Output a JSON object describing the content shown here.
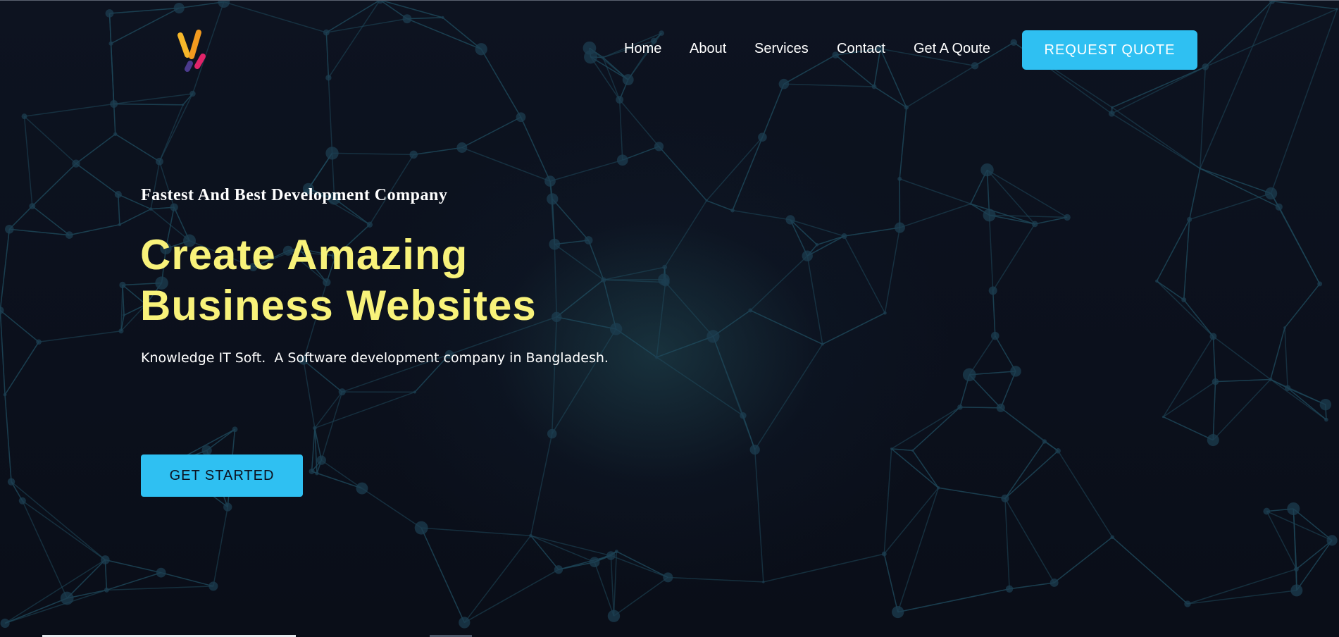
{
  "nav": {
    "items": [
      {
        "label": "Home"
      },
      {
        "label": "About"
      },
      {
        "label": "Services"
      },
      {
        "label": "Contact"
      },
      {
        "label": "Get A Qoute"
      }
    ],
    "cta_label": "REQUEST QUOTE"
  },
  "hero": {
    "tagline": "Fastest And Best Development Company",
    "headline_line1": "Create Amazing",
    "headline_line2": "Business Websites",
    "description": "Knowledge IT Soft.  A Software development company in Bangladesh.",
    "cta_label": "GET STARTED"
  },
  "colors": {
    "background": "#0b0f1a",
    "accent": "#2fc0f2",
    "headline": "#f8f27a",
    "network_lines": "#1f4a5c"
  },
  "icons": {
    "logo": "logo-icon"
  }
}
